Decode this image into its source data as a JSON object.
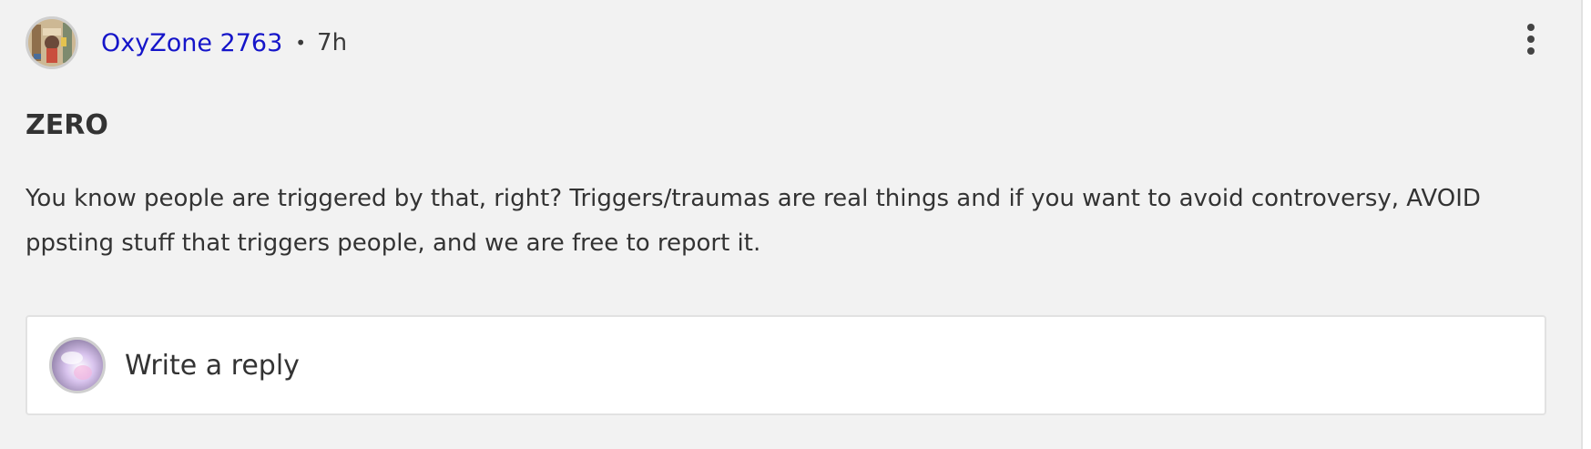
{
  "post": {
    "author": "OxyZone 2763",
    "separator": "•",
    "time": "7h",
    "title": "ZERO",
    "body": "You know people are triggered by that, right? Triggers/traumas are real things and if you want to avoid controversy, AVOID ppsting stuff that triggers people, and we are free to report it.",
    "author_avatar": "author-avatar-photo",
    "menu_icon": "more-vertical-icon"
  },
  "reply": {
    "placeholder": "Write a reply",
    "avatar": "current-user-avatar"
  },
  "colors": {
    "background": "#f2f2f2",
    "author_link": "#1515c9",
    "text": "#333333",
    "reply_box": "#ffffff",
    "border": "#e2e2e2"
  }
}
